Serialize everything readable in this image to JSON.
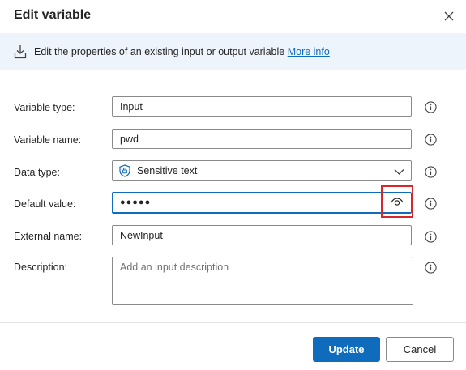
{
  "dialog": {
    "title": "Edit variable",
    "banner_text": "Edit the properties of an existing input or output variable ",
    "banner_link": "More info"
  },
  "fields": {
    "variable_type": {
      "label": "Variable type:",
      "value": "Input"
    },
    "variable_name": {
      "label": "Variable name:",
      "value": "pwd"
    },
    "data_type": {
      "label": "Data type:",
      "value": "Sensitive text"
    },
    "default_value": {
      "label": "Default value:",
      "value": "●●●●●"
    },
    "external_name": {
      "label": "External name:",
      "value": "NewInput"
    },
    "description": {
      "label": "Description:",
      "placeholder": "Add an input description"
    }
  },
  "buttons": {
    "update": "Update",
    "cancel": "Cancel"
  },
  "icons": {
    "close": "close-icon",
    "download": "download-icon",
    "info": "info-icon",
    "shield": "shield-lock-icon",
    "chevron": "chevron-down-icon",
    "eye": "eye-icon"
  },
  "colors": {
    "accent": "#0f6cbd",
    "banner_bg": "#eef4fb",
    "highlight": "#d9262b"
  }
}
